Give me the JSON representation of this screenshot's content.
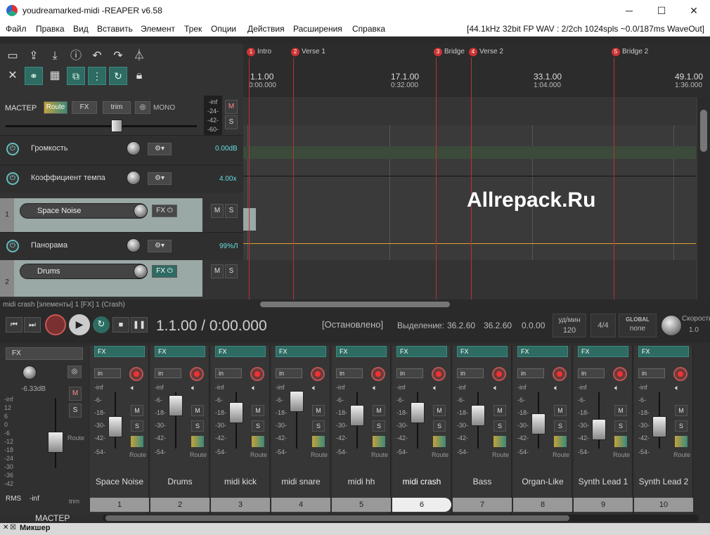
{
  "window": {
    "title": "youdreamarked-midi -REAPER v6.58",
    "minimize": "─",
    "maximize": "☐",
    "close": "✕"
  },
  "menu": {
    "items": [
      "Файл",
      "Правка",
      "Вид",
      "Вставить",
      "Элемент",
      "Трек",
      "Опции",
      "Действия",
      "Расширения",
      "Справка"
    ],
    "status": "[44.1kHz 32bit FP WAV : 2/2ch 1024spls ~0.0/187ms WaveOut]"
  },
  "master": {
    "label": "МАСТЕР",
    "route": "Route",
    "fx": "FX",
    "trim": "trim",
    "mono": "MONO",
    "meter": [
      "-inf",
      "-24-",
      "-42-",
      "-60-"
    ],
    "m": "M",
    "s": "S"
  },
  "envelopes": [
    {
      "name": "Громкость",
      "value": "0.00dB"
    },
    {
      "name": "Коэффициент темпа",
      "value": "4.00x"
    },
    {
      "name": "Панорама",
      "value": "99%Л"
    }
  ],
  "tracks": [
    {
      "num": "1",
      "name": "Space Noise"
    },
    {
      "num": "2",
      "name": "Drums"
    }
  ],
  "track_status": "midi crash [элементы] 1 [FX] 1 (Crash)",
  "markers": [
    {
      "n": "1",
      "name": "Intro"
    },
    {
      "n": "2",
      "name": "Verse 1"
    },
    {
      "n": "3",
      "name": "Bridge"
    },
    {
      "n": "4",
      "name": "Verse 2"
    },
    {
      "n": "5",
      "name": "Bridge 2"
    }
  ],
  "ruler": [
    {
      "bar": "1.1.00",
      "time": "0:00.000"
    },
    {
      "bar": "17.1.00",
      "time": "0:32.000"
    },
    {
      "bar": "33.1.00",
      "time": "1:04.000"
    },
    {
      "bar": "49.1.00",
      "time": "1:36.000"
    }
  ],
  "watermark": "Allrepack.Ru",
  "transport": {
    "time": "1.1.00 / 0:00.000",
    "state": "[Остановлено]",
    "sel_label": "Выделение:",
    "sel_start": "36.2.60",
    "sel_end": "36.2.60",
    "sel_len": "0.0.00",
    "bpm_label": "уд/мин",
    "bpm": "120",
    "timesig": "4/4",
    "global": "GLOBAL",
    "none": "none",
    "rate_label": "Скорость",
    "rate": "1.0"
  },
  "mixer_master": {
    "db": "-6.33dB",
    "m": "M",
    "s": "S",
    "route": "Route",
    "rms": "RMS",
    "rms_val": "-inf",
    "trim": "trim",
    "label": "МАСТЕР",
    "fx": "FX",
    "scale_l": [
      "-inf",
      "12",
      "6",
      "0",
      "-6",
      "-12",
      "-18",
      "-24",
      "-30",
      "-36",
      "-42"
    ],
    "scale_m": [
      "-inf",
      "-6",
      "-18",
      "-30",
      "-42",
      "-54"
    ]
  },
  "strips": [
    {
      "name": "Space Noise",
      "num": "1"
    },
    {
      "name": "Drums",
      "num": "2"
    },
    {
      "name": "midi kick",
      "num": "3"
    },
    {
      "name": "midi snare",
      "num": "4"
    },
    {
      "name": "midi hh",
      "num": "5"
    },
    {
      "name": "midi crash",
      "num": "6"
    },
    {
      "name": "Bass",
      "num": "7"
    },
    {
      "name": "Organ-Like",
      "num": "8"
    },
    {
      "name": "Synth Lead 1",
      "num": "9"
    },
    {
      "name": "Synth Lead 2",
      "num": "10"
    }
  ],
  "strip_common": {
    "fx": "FX",
    "in": "in",
    "scale": [
      "-inf",
      "-6-",
      "-18-",
      "-30-",
      "-42-",
      "-54-"
    ],
    "m": "M",
    "s": "S",
    "route": "Route"
  },
  "mixer_tab": "Микшер",
  "colors": {
    "accent": "#2e6b62",
    "marker": "#cc3333",
    "envelope": "#e0a030"
  }
}
